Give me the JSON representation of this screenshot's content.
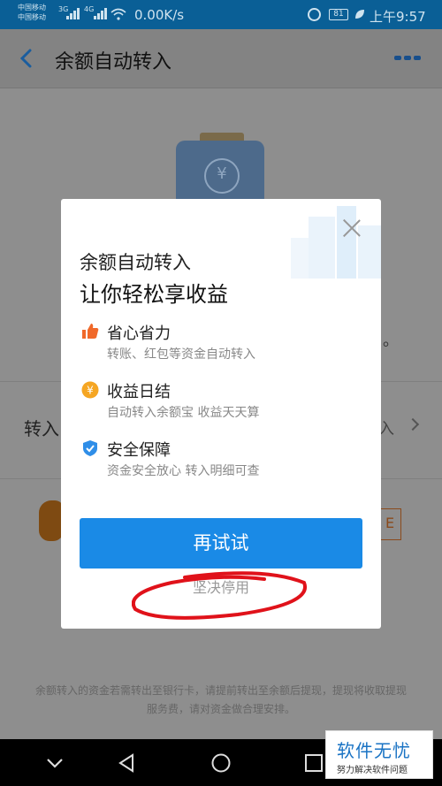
{
  "status_bar": {
    "carrier_1": "中国移动",
    "carrier_2": "中国移动",
    "sig1": "3G",
    "sig2": "4G",
    "speed": "0.00K/s",
    "battery": "81",
    "time": "上午9:57"
  },
  "header": {
    "title": "余额自动转入",
    "back_icon": "chevron-left-icon",
    "more_icon": "more-icon"
  },
  "background_page": {
    "row_label": "转入",
    "row_value": "入",
    "dot": "。",
    "tag": "E",
    "footer_text": "余额转入的资金若需转出至银行卡，请提前转出至余额后提现，提现将收取提现服务费，请对资金做合理安排。"
  },
  "dialog": {
    "title_line1": "余额自动转入",
    "title_line2": "让你轻松享收益",
    "features": [
      {
        "icon": "thumbs-up-icon",
        "title": "省心省力",
        "desc": "转账、红包等资金自动转入",
        "color": "#f0692a"
      },
      {
        "icon": "yuan-coin-icon",
        "title": "收益日结",
        "desc": "自动转入余额宝 收益天天算",
        "color": "#f5a623"
      },
      {
        "icon": "shield-check-icon",
        "title": "安全保障",
        "desc": "资金安全放心 转入明细可查",
        "color": "#2f8ee8"
      }
    ],
    "primary_button": "再试试",
    "secondary_link": "坚决停用",
    "accent_color": "#1a8ae6"
  },
  "watermark": {
    "big": "软件无忧",
    "small": "努力解决软件问题"
  }
}
